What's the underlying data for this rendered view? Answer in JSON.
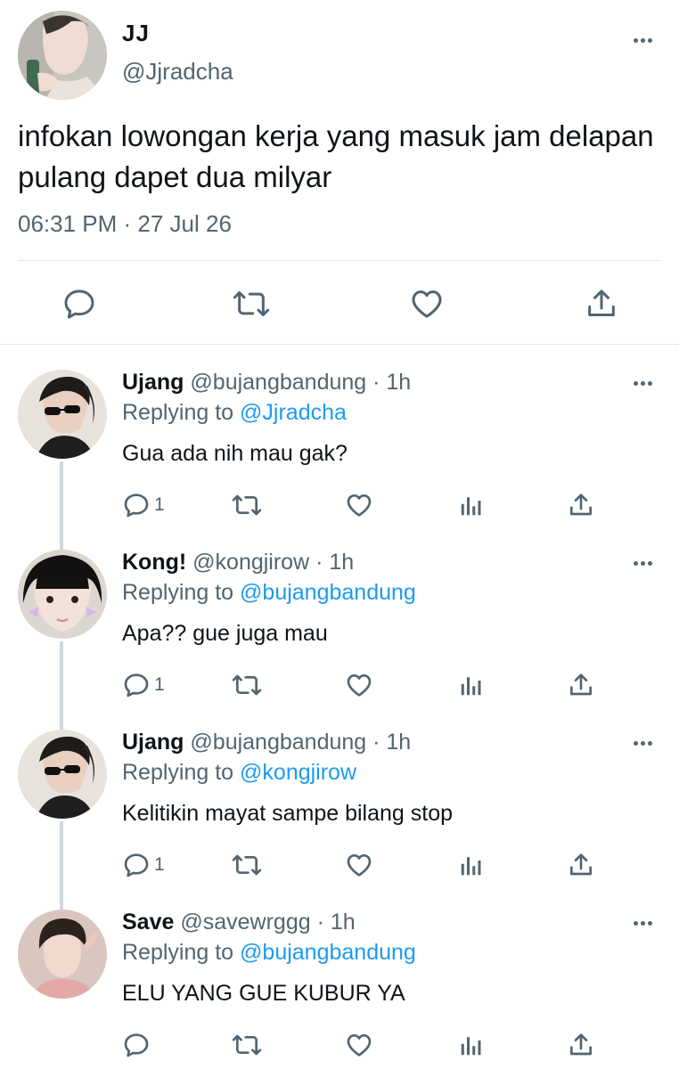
{
  "main_tweet": {
    "name": "JJ",
    "handle": "@Jjradcha",
    "text": "infokan lowongan kerja yang masuk jam delapan pulang dapet dua milyar",
    "timestamp": "06:31 PM · 27 Jul 26",
    "actions": [
      "reply-icon",
      "retweet-icon",
      "like-icon",
      "share-icon"
    ]
  },
  "replies": [
    {
      "name": "Ujang",
      "meta": "@bujangbandung · 1h",
      "replying_prefix": "Replying to",
      "replying_to": "@Jjradcha",
      "text": "Gua ada nih mau gak?",
      "reply_count": "1"
    },
    {
      "name": "Kong!",
      "meta": "@kongjirow · 1h",
      "replying_prefix": "Replying to",
      "replying_to": "@bujangbandung",
      "text": "Apa?? gue juga mau",
      "reply_count": "1"
    },
    {
      "name": "Ujang",
      "meta": "@bujangbandung · 1h",
      "replying_prefix": "Replying to",
      "replying_to": "@kongjirow",
      "text": "Kelitikin mayat sampe bilang stop",
      "reply_count": "1"
    },
    {
      "name": "Save",
      "meta": "@savewrggg · 1h",
      "replying_prefix": "Replying to",
      "replying_to": "@bujangbandung",
      "text": "ELU YANG GUE KUBUR YA",
      "reply_count": ""
    }
  ],
  "colors": {
    "text": "#0f1419",
    "secondary": "#536471",
    "mention": "#1d9bf0",
    "divider": "#e3e6e8",
    "thread_line": "#cfd9de"
  }
}
